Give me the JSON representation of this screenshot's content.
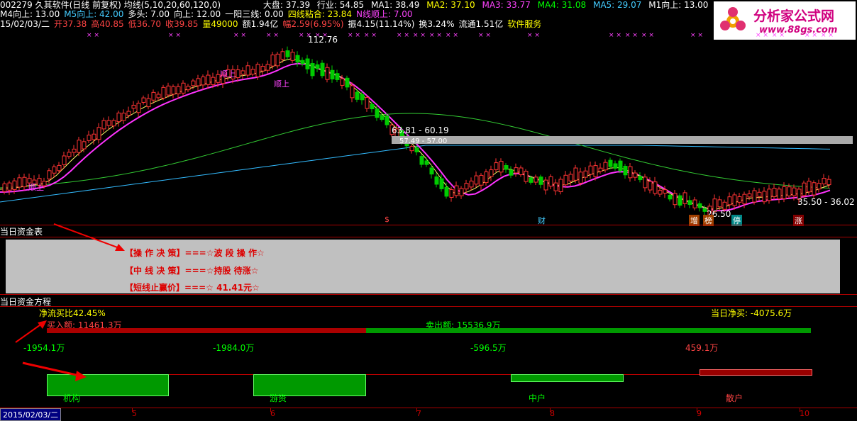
{
  "header": {
    "title_line": "002279 久其软件(日线 前复权) 均线(5,10,20,60,120,0)",
    "market": "大盘: 37.39",
    "industry": "行业: 54.85",
    "ma_values": [
      {
        "label": "MA1: 38.49",
        "color": "#ffffff"
      },
      {
        "label": "MA2: 37.10",
        "color": "#ffff00"
      },
      {
        "label": "MA3: 33.77",
        "color": "#ff44ff"
      },
      {
        "label": "MA4: 31.08",
        "color": "#00ff00"
      },
      {
        "label": "MA5: 29.07",
        "color": "#44ccff"
      },
      {
        "label": "M1向上: 13.00",
        "color": "#ffffff"
      }
    ],
    "trend_items": [
      {
        "label": "M4向上: 13.00",
        "color": "#ffffff"
      },
      {
        "label": "M5向上: 42.00",
        "color": "#44ccff"
      },
      {
        "label": "多头: 7.00",
        "color": "#ffffff"
      },
      {
        "label": "向上: 12.00",
        "color": "#ffffff"
      },
      {
        "label": "一阳三线: 0.00",
        "color": "#ffffff"
      },
      {
        "label": "四线粘合: 23.84",
        "color": "#ffff00"
      },
      {
        "label": "N线顺上: 7.00",
        "color": "#ff44ff"
      }
    ],
    "quote_items": [
      {
        "label": "15/02/03/二",
        "color": "#ffffff"
      },
      {
        "label": "开37.38",
        "color": "#ff4444"
      },
      {
        "label": "高40.85",
        "color": "#ff4444"
      },
      {
        "label": "低36.70",
        "color": "#ff4444"
      },
      {
        "label": "收39.85",
        "color": "#ff4444"
      },
      {
        "label": "量49000",
        "color": "#ffff00"
      },
      {
        "label": "额1.94亿",
        "color": "#ffffff"
      },
      {
        "label": "幅2.59(6.95%)",
        "color": "#ff4444"
      },
      {
        "label": "振4.15(11.14%)",
        "color": "#ffffff"
      },
      {
        "label": "换3.24%",
        "color": "#ffffff"
      },
      {
        "label": "流通1.51亿",
        "color": "#ffffff"
      },
      {
        "label": "软件服务",
        "color": "#ffff00"
      }
    ]
  },
  "logo": {
    "text": "分析家公式网",
    "url": "www.88gs.com"
  },
  "kline": {
    "high_label": "112.76",
    "low_label": "26.50",
    "range_labels": [
      "63.81 - 60.19",
      "57.49 - 57.00"
    ],
    "right_label": "35.50 - 36.02",
    "tags": [
      "顺上",
      "顺上",
      "顺上"
    ],
    "bottom_markers": [
      {
        "text": "$",
        "color": "#ff4444"
      },
      {
        "text": "财",
        "color": "#44ccff"
      },
      {
        "text": "增",
        "color": "#ffffff"
      },
      {
        "text": "榜",
        "color": "#ffffff"
      },
      {
        "text": "停",
        "color": "#ffffff"
      },
      {
        "text": "涨",
        "color": "#ffffff"
      }
    ]
  },
  "fund_table": {
    "title": "当日资金表",
    "lines": [
      "【操 作 决 策】===☆波 段 操 作☆",
      "【中 线 决 策】===☆持股 待涨☆",
      "【短线止赢价】===☆ 41.41元☆"
    ]
  },
  "fund_equation": {
    "title": "当日资金方程",
    "net_ratio": "净流买比42.45%",
    "net_buy": "当日净买: -4075.6万",
    "buy_amount": "买入额: 11461.3万",
    "sell_amount": "卖出额: 15536.9万",
    "flows": [
      "-1954.1万",
      "-1984.0万",
      "-596.5万",
      "459.1万"
    ],
    "groups": [
      {
        "label": "机构",
        "value": -1954.1
      },
      {
        "label": "游资",
        "value": -1984.0
      },
      {
        "label": "中户",
        "value": -596.5
      },
      {
        "label": "散户",
        "value": 459.1
      }
    ]
  },
  "x_axis": {
    "date": "2015/02/03/二",
    "months": [
      "5",
      "6",
      "7",
      "8",
      "9",
      "10"
    ]
  },
  "colors": {
    "up": "#ff3333",
    "down": "#00cc00",
    "ma_pink": "#ff33ff",
    "ma_green": "#33cc33",
    "ma_blue": "#33bbff"
  }
}
